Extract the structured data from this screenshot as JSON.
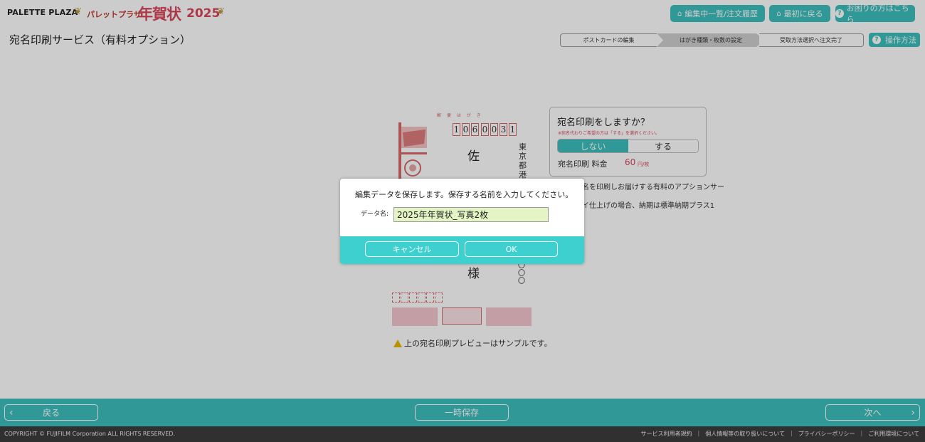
{
  "header": {
    "logo": "PALETTE PLAZA",
    "logo_sub": "パレットプラザ",
    "logo_nenga": "年賀状",
    "logo_year": "2025",
    "buttons": [
      "編集中一覧/注文履歴",
      "最初に戻る",
      "お困りの方はこちら"
    ]
  },
  "page_title": "宛名印刷サービス（有料オプション）",
  "steps": [
    "ポストカードの編集",
    "はがき種類・枚数の設定",
    "受取方法選択へ注文完了"
  ],
  "howto": "操作方法",
  "postcard": {
    "top_label": "郵 便 は が き",
    "zip": [
      "1",
      "0",
      "6",
      "0",
      "0",
      "3",
      "1"
    ],
    "address": "東京都港",
    "name1": "佐",
    "name2": "様",
    "address2": "〇〇〇",
    "warning": "上の宛名印刷プレビューはサンプルです。"
  },
  "options": {
    "question": "宛名印刷をしますか？",
    "note": "※宛名代わりご希望の方は「する」を選択ください。",
    "no": "しない",
    "yes": "する",
    "fee_label": "宛名印刷 料金",
    "fee_value": "60",
    "fee_unit": "円/枚",
    "desc1": "名を印刷しお届けする有料のアプションサー",
    "desc2": "イ仕上げの場合、納期は標準納期プラス1"
  },
  "footer": {
    "back": "戻る",
    "save": "一時保存",
    "next": "次へ",
    "copyright": "COPYRIGHT © FUJIFILM Corporation ALL RIGHTS RESERVED.",
    "links": [
      "サービス利用者規約",
      "個人情報等の取り扱いについて",
      "プライバシーポリシー",
      "ご利用環境について"
    ]
  },
  "dialog": {
    "message": "編集データを保存します。保存する名前を入力してください。",
    "label": "データ名:",
    "value": "2025年年賀状_写真2枚",
    "cancel": "キャンセル",
    "ok": "OK"
  }
}
